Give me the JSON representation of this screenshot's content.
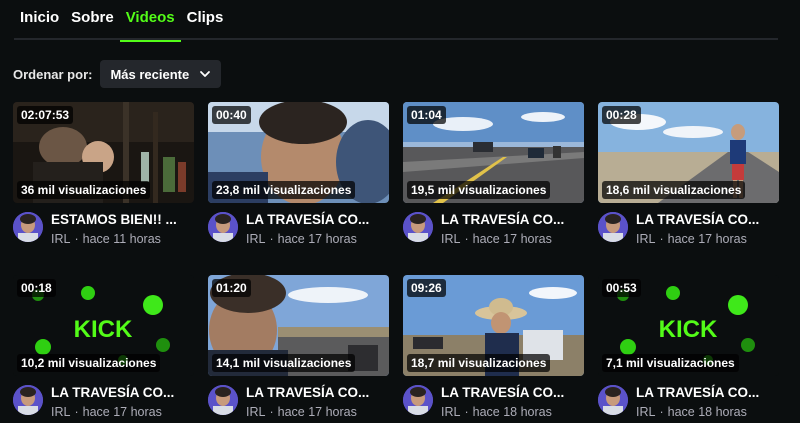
{
  "tabs": [
    {
      "label": "Inicio",
      "active": false
    },
    {
      "label": "Sobre",
      "active": false
    },
    {
      "label": "Videos",
      "active": true
    },
    {
      "label": "Clips",
      "active": false
    }
  ],
  "sort": {
    "label": "Ordenar por:",
    "value": "Más reciente"
  },
  "colors": {
    "accent": "#53fc18",
    "background": "#0b0e0f",
    "muted": "#adadb8"
  },
  "videos": [
    {
      "duration": "02:07:53",
      "views": "36 mil visualizaciones",
      "title": "ESTAMOS BIEN!! ...",
      "category": "IRL",
      "time": "hace 11 horas",
      "thumb": "night-group"
    },
    {
      "duration": "00:40",
      "views": "23,8 mil visualizaciones",
      "title": "LA TRAVESÍA CO...",
      "category": "IRL",
      "time": "hace 17 horas",
      "thumb": "selfie-closeup"
    },
    {
      "duration": "01:04",
      "views": "19,5 mil visualizaciones",
      "title": "LA TRAVESÍA CO...",
      "category": "IRL",
      "time": "hace 17 horas",
      "thumb": "highway-trucks"
    },
    {
      "duration": "00:28",
      "views": "18,6 mil visualizaciones",
      "title": "LA TRAVESÍA CO...",
      "category": "IRL",
      "time": "hace 17 horas",
      "thumb": "road-person"
    },
    {
      "duration": "00:18",
      "views": "10,2 mil visualizaciones",
      "title": "LA TRAVESÍA CO...",
      "category": "IRL",
      "time": "hace 17 horas",
      "thumb": "kick-logo"
    },
    {
      "duration": "01:20",
      "views": "14,1 mil visualizaciones",
      "title": "LA TRAVESÍA CO...",
      "category": "IRL",
      "time": "hace 17 horas",
      "thumb": "road-selfie"
    },
    {
      "duration": "09:26",
      "views": "18,7 mil visualizaciones",
      "title": "LA TRAVESÍA CO...",
      "category": "IRL",
      "time": "hace 18 horas",
      "thumb": "hat-man"
    },
    {
      "duration": "00:53",
      "views": "7,1 mil visualizaciones",
      "title": "LA TRAVESÍA CO...",
      "category": "IRL",
      "time": "hace 18 horas",
      "thumb": "kick-logo"
    }
  ]
}
